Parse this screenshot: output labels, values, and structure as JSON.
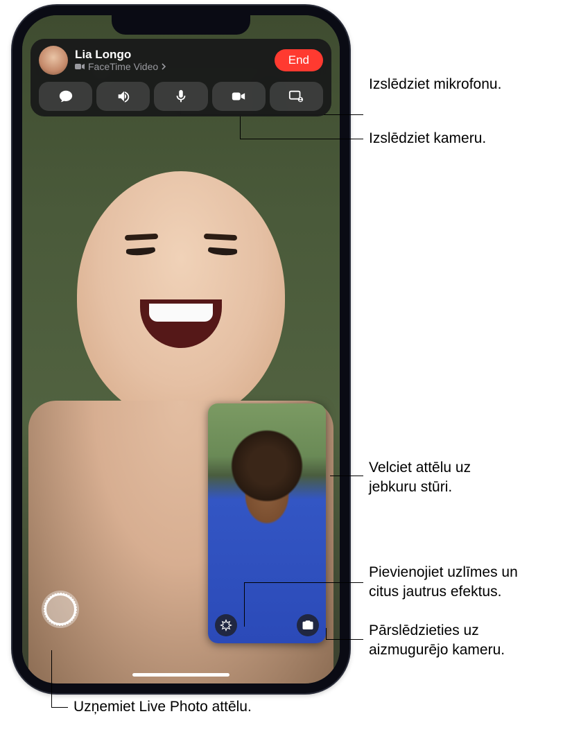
{
  "caller": {
    "name": "Lia Longo",
    "subtitle": "FaceTime Video"
  },
  "end_button": "End",
  "controls": {
    "messages": "messages",
    "speaker": "speaker",
    "mute": "mute",
    "camera": "camera",
    "screenshare": "screen-share"
  },
  "pip": {
    "effects": "effects",
    "flip": "flip-camera"
  },
  "live_photo": "live-photo",
  "callouts": {
    "mute_mic": "Izslēdziet mikrofonu.",
    "camera_off": "Izslēdziet kameru.",
    "drag_pip_1": "Velciet attēlu uz",
    "drag_pip_2": "jebkuru stūri.",
    "effects_1": "Pievienojiet uzlīmes un",
    "effects_2": "citus jautrus efektus.",
    "flip_1": "Pārslēdzieties uz",
    "flip_2": "aizmugurējo kameru.",
    "live_photo": "Uzņemiet Live Photo attēlu."
  }
}
